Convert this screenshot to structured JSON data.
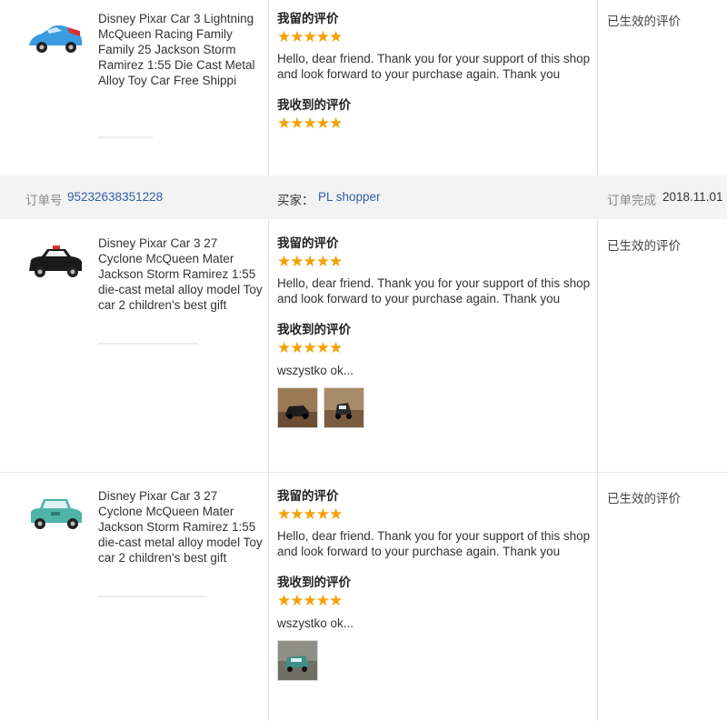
{
  "blocks": [
    {
      "product_title": "Disney Pixar Car 3 Lightning McQueen Racing Family Family 25 Jackson Storm Ramirez 1:55 Die Cast Metal Alloy Toy Car Free Shippi",
      "my_review_label": "我留的评价",
      "my_stars": "★★★★★",
      "my_review_text": "Hello, dear friend. Thank you for your support of this shop and look forward to your purchase again. Thank you",
      "received_label": "我收到的评价",
      "received_stars": "★★★★★",
      "status": "已生效的评价"
    },
    {
      "product_title": "Disney Pixar Car 3 27 Cyclone McQueen Mater Jackson Storm Ramirez 1:55 die-cast metal alloy model Toy car 2 children's best gift",
      "my_review_label": "我留的评价",
      "my_stars": "★★★★★",
      "my_review_text": "Hello, dear friend. Thank you for your support of this shop and look forward to your purchase again. Thank you",
      "received_label": "我收到的评价",
      "received_stars": "★★★★★",
      "received_text": "wszystko ok...",
      "status": "已生效的评价"
    },
    {
      "product_title": "Disney Pixar Car 3 27 Cyclone McQueen Mater Jackson Storm Ramirez 1:55 die-cast metal alloy model Toy car 2 children's best gift",
      "my_review_label": "我留的评价",
      "my_stars": "★★★★★",
      "my_review_text": "Hello, dear friend. Thank you for your support of this shop and look forward to your purchase again. Thank you",
      "received_label": "我收到的评价",
      "received_stars": "★★★★★",
      "received_text": "wszystko ok...",
      "status": "已生效的评价"
    }
  ],
  "order": {
    "number_label": "订单号",
    "number": "95232638351228",
    "buyer_label": "买家：",
    "buyer": "PL shopper",
    "completed_label": "订单完成",
    "completed_date": "2018.11.01"
  },
  "colors": {
    "star": "#f5a000",
    "link": "#2f5fa5",
    "order_bar_bg": "#f3f3f3"
  }
}
